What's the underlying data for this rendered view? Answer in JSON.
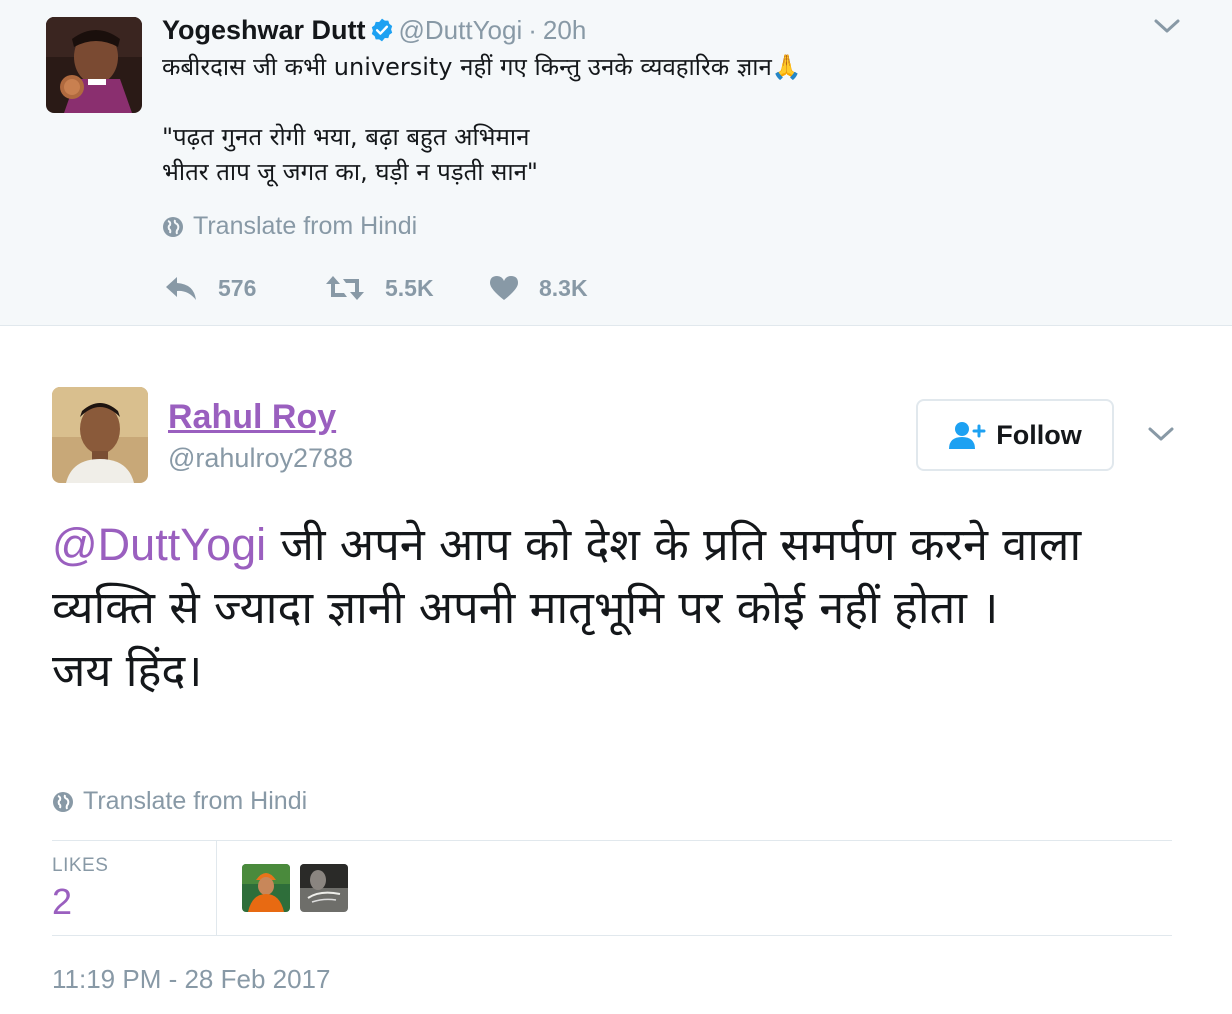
{
  "parent_tweet": {
    "author_name": "Yogeshwar Dutt",
    "handle": "@DuttYogi",
    "separator": "·",
    "time": "20h",
    "text_lines": [
      "कबीरदास जी कभी university नहीं गए किन्तु उनके व्यवहारिक ज्ञान🙏",
      "",
      "\"पढ़त गुनत रोगी भया, बढ़ा बहुत अभिमान",
      "भीतर ताप जू जगत का, घड़ी न पड़ती सान\""
    ],
    "translate_label": "Translate from Hindi",
    "replies": "576",
    "retweets": "5.5K",
    "likes": "8.3K"
  },
  "main_tweet": {
    "author_name": "Rahul Roy",
    "handle": "@rahulroy2788",
    "follow_label": "Follow",
    "mention": "@DuttYogi",
    "text": " जी अपने आप को देश के प्रति समर्पण करने वाला व्यक्ति से ज्यादा ज्ञानी अपनी मातृभूमि पर कोई नहीं होता ।",
    "text_line2": "जय हिंद।",
    "translate_label": "Translate from Hindi",
    "likes_label": "LIKES",
    "likes_count": "2",
    "timestamp": "11:19 PM - 28 Feb 2017"
  },
  "colors": {
    "accent": "#9a5fbf",
    "muted": "#8899a6",
    "verified": "#1da1f2",
    "parent_bg": "#f5f8fa",
    "border": "#e1e8ed"
  },
  "icons": {
    "verified": "verified-badge-icon",
    "chevron": "chevron-down-icon",
    "globe": "globe-icon",
    "reply": "reply-icon",
    "retweet": "retweet-icon",
    "like": "heart-icon",
    "follow": "follow-person-plus-icon"
  }
}
